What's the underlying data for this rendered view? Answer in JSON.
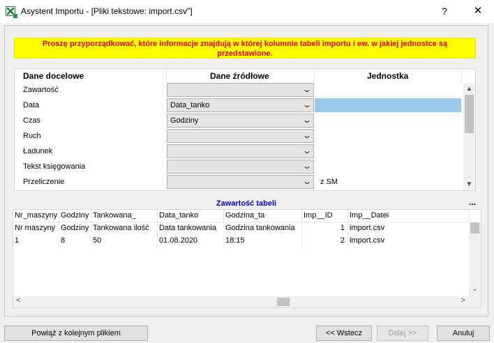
{
  "window": {
    "title": "Asystent Importu - [Pliki tekstowe: import.csv\"]",
    "help": "?",
    "close": "✕"
  },
  "notice": "Proszę przyporządkować, które informacje znajdują w której kolumnie tabeli importu i ew. w jakiej jednostce są przedstawione.",
  "mapping": {
    "headers": {
      "target": "Dane docelowe",
      "source": "Dane źródłowe",
      "unit": "Jednostka"
    },
    "rows": [
      {
        "label": "Zawartość",
        "source": "",
        "unit": ""
      },
      {
        "label": "Data",
        "source": "Data_tanko",
        "unit": ""
      },
      {
        "label": "Czas",
        "source": "Godziny",
        "unit": ""
      },
      {
        "label": "Ruch",
        "source": "",
        "unit": ""
      },
      {
        "label": "Ładunek",
        "source": "",
        "unit": ""
      },
      {
        "label": "Tekst księgowania",
        "source": "",
        "unit": ""
      },
      {
        "label": "Przeliczenie",
        "source": "",
        "unit": "z SM"
      }
    ]
  },
  "table": {
    "title": "Zawartość tabeli",
    "more": "...",
    "columns": [
      "Nr_maszyny",
      "Godziny",
      "Tankowana_",
      "Data_tanko",
      "Godzina_ta",
      "Imp__ID",
      "Imp__Datei"
    ],
    "rows": [
      [
        "Nr maszyny",
        "Godziny",
        "Tankowana ilość",
        "Data tankowania",
        "Godzina tankowania",
        "1",
        "import.csv"
      ],
      [
        "1",
        "8",
        "50",
        "01.08.2020",
        "18:15",
        "2",
        "import.csv"
      ]
    ]
  },
  "buttons": {
    "link": "Powiąż z kolejnym plikiem",
    "back": "<< Wstecz",
    "next": "Dalej >>",
    "cancel": "Anuluj"
  },
  "icons": {
    "app": "excel-icon",
    "combo_arrow": "chevron-down-icon",
    "scroll_up": "chevron-up-icon",
    "scroll_down": "chevron-down-icon",
    "scroll_left": "chevron-left-icon",
    "scroll_right": "chevron-right-icon"
  },
  "colors": {
    "notice_bg": "#ffff00",
    "notice_text": "#e00000",
    "table_title": "#0000c0",
    "selection": "#99c9ef"
  }
}
